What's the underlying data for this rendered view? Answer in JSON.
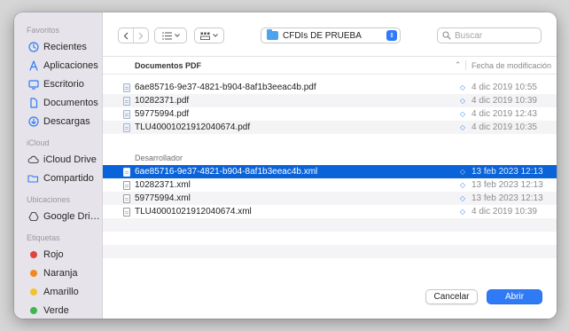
{
  "sidebar": {
    "sections": [
      {
        "title": "Favoritos",
        "items": [
          {
            "label": "Recientes",
            "icon": "clock-icon"
          },
          {
            "label": "Aplicaciones",
            "icon": "apps-icon"
          },
          {
            "label": "Escritorio",
            "icon": "desktop-icon"
          },
          {
            "label": "Documentos",
            "icon": "document-icon"
          },
          {
            "label": "Descargas",
            "icon": "download-icon"
          }
        ]
      },
      {
        "title": "iCloud",
        "items": [
          {
            "label": "iCloud Drive",
            "icon": "cloud-icon"
          },
          {
            "label": "Compartido",
            "icon": "shared-folder-icon"
          }
        ]
      },
      {
        "title": "Ubicaciones",
        "items": [
          {
            "label": "Google Drive",
            "icon": "drive-icon"
          }
        ]
      },
      {
        "title": "Etiquetas",
        "items": [
          {
            "label": "Rojo",
            "color": "#e0443e"
          },
          {
            "label": "Naranja",
            "color": "#f08a24"
          },
          {
            "label": "Amarillo",
            "color": "#f2c230"
          },
          {
            "label": "Verde",
            "color": "#3cb84c"
          }
        ]
      }
    ]
  },
  "toolbar": {
    "location": "CFDIs DE PRUEBA",
    "search_placeholder": "Buscar"
  },
  "columns": {
    "group_header": "Documentos PDF",
    "date_header": "Fecha de modificación"
  },
  "groups": [
    {
      "title": "Documentos PDF",
      "files": [
        {
          "name": "6ae85716-9e37-4821-b904-8af1b3eeac4b.pdf",
          "date": "4 dic 2019 10:55"
        },
        {
          "name": "10282371.pdf",
          "date": "4 dic 2019 10:39"
        },
        {
          "name": "59775994.pdf",
          "date": "4 dic 2019 12:43"
        },
        {
          "name": "TLU40001021912040674.pdf",
          "date": "4 dic 2019 10:35"
        }
      ]
    },
    {
      "title": "Desarrollador",
      "files": [
        {
          "name": "6ae85716-9e37-4821-b904-8af1b3eeac4b.xml",
          "date": "13 feb 2023 12:13",
          "selected": true
        },
        {
          "name": "10282371.xml",
          "date": "13 feb 2023 12:13"
        },
        {
          "name": "59775994.xml",
          "date": "13 feb 2023 12:13"
        },
        {
          "name": "TLU40001021912040674.xml",
          "date": "4 dic 2019 10:39"
        }
      ]
    }
  ],
  "footer": {
    "cancel_label": "Cancelar",
    "open_label": "Abrir"
  }
}
